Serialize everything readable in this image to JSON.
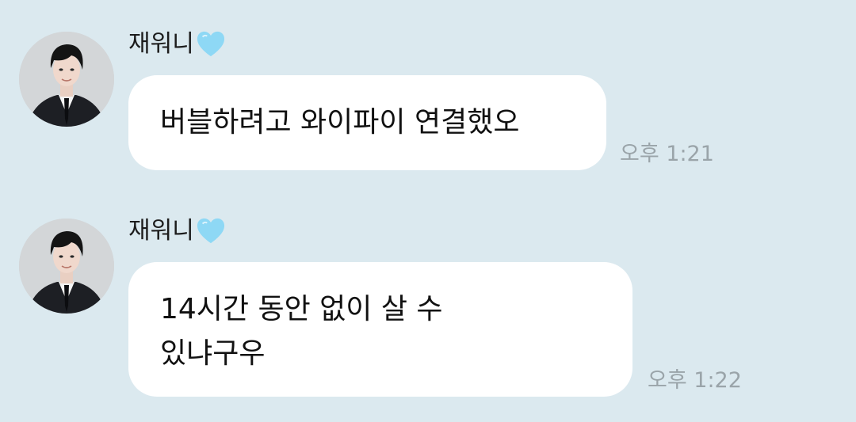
{
  "messages": [
    {
      "sender": "재워니",
      "text_lines": [
        "버블하려고 와이파이 연결했오"
      ],
      "time": "오후 1:21"
    },
    {
      "sender": "재워니",
      "text_lines": [
        "14시간 동안 없이 살 수",
        "있냐구우"
      ],
      "time": "오후 1:22"
    }
  ],
  "icons": {
    "avatar": "profile-photo-avatar",
    "heart": "light-blue-heart-icon"
  },
  "colors": {
    "background": "#dbe9ef",
    "bubble": "#ffffff",
    "timestamp": "#9aa4a9",
    "heart": "#8ed8f5"
  }
}
